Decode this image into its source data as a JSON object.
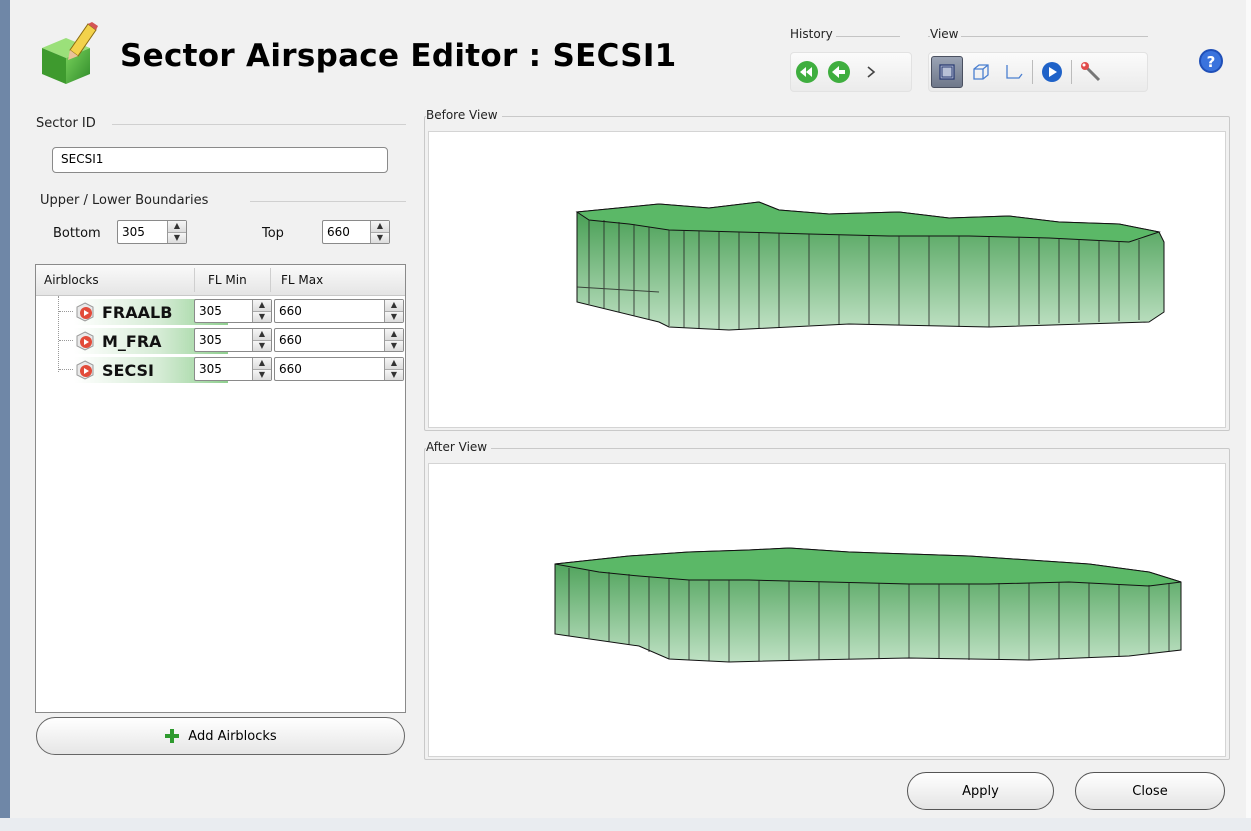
{
  "title": "Sector Airspace Editor : SECSI1",
  "toolbar": {
    "history_label": "History",
    "view_label": "View",
    "history_icons": [
      "rewind-icon",
      "back-arrow-icon",
      "forward-chevron-icon"
    ],
    "view_icons": [
      "box-flat-icon",
      "box-3d-icon",
      "profile-icon",
      "play-icon",
      "wand-icon"
    ]
  },
  "sector": {
    "id_label": "Sector ID",
    "id_value": "SECSI1",
    "boundaries_label": "Upper / Lower Boundaries",
    "bottom_label": "Bottom",
    "bottom_value": "305",
    "top_label": "Top",
    "top_value": "660"
  },
  "airblocks": {
    "columns": [
      "Airblocks",
      "FL Min",
      "FL Max"
    ],
    "rows": [
      {
        "name": "FRAALB",
        "fl_min": "305",
        "fl_max": "660"
      },
      {
        "name": "M_FRA",
        "fl_min": "305",
        "fl_max": "660"
      },
      {
        "name": "SECSI",
        "fl_min": "305",
        "fl_max": "660"
      }
    ],
    "add_label": "Add Airblocks"
  },
  "views": {
    "before_label": "Before View",
    "after_label": "After View"
  },
  "buttons": {
    "apply": "Apply",
    "close": "Close"
  },
  "colors": {
    "accent_green": "#57a85e",
    "window_bg": "#f1f1f1",
    "desktop_bg": "#6f87a7"
  }
}
